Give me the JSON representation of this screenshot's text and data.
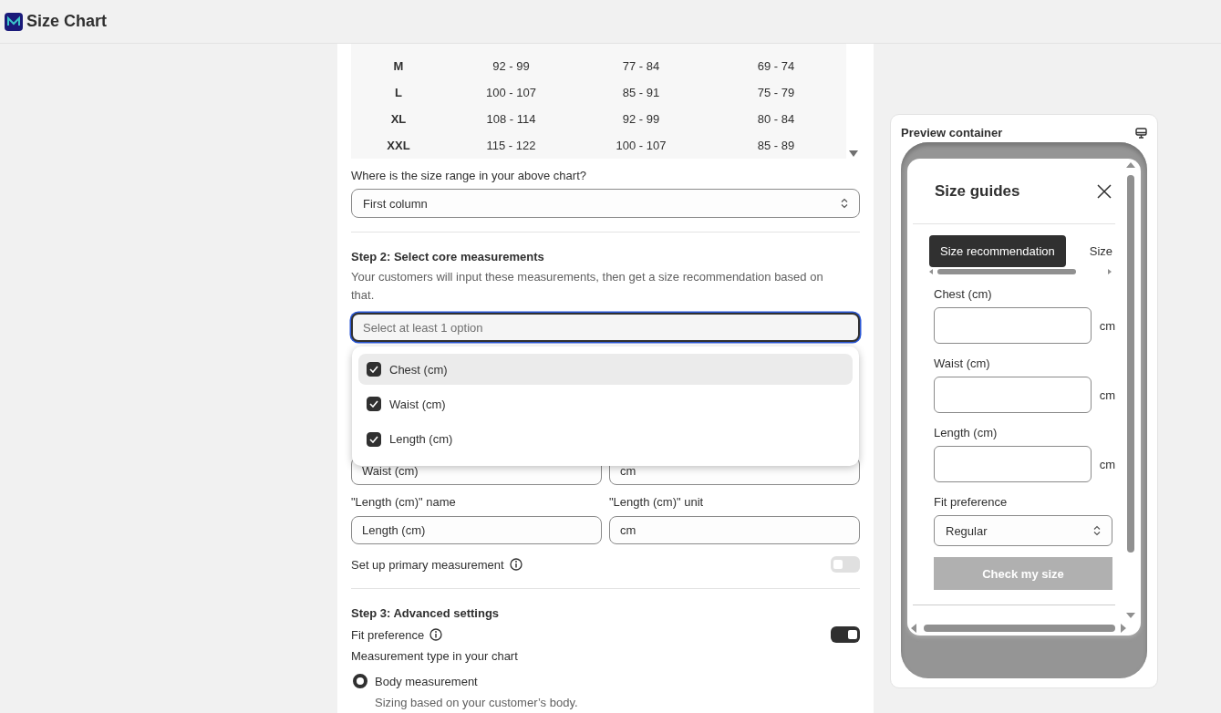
{
  "app": {
    "title": "Size Chart"
  },
  "chart_table": {
    "rows": [
      {
        "size": "M",
        "column_2": "92 - 99",
        "column_3": "77 - 84",
        "column_4": "69 - 74"
      },
      {
        "size": "L",
        "column_2": "100 - 107",
        "column_3": "85 - 91",
        "column_4": "75 - 79"
      },
      {
        "size": "XL",
        "column_2": "108 - 114",
        "column_3": "92 - 99",
        "column_4": "80 - 84"
      },
      {
        "size": "XXL",
        "column_2": "115 - 122",
        "column_3": "100 - 107",
        "column_4": "85 - 89"
      }
    ]
  },
  "size_range": {
    "label": "Where is the size range in your above chart?",
    "value": "First column"
  },
  "step2": {
    "heading": "Step 2: Select core measurements",
    "description": "Your customers will input these measurements, then get a size recommendation based on that.",
    "multiselect": {
      "placeholder": "Select at least 1 option",
      "focused": true,
      "options": [
        {
          "label": "Chest (cm)",
          "checked": true,
          "highlighted": true
        },
        {
          "label": "Waist (cm)",
          "checked": true,
          "highlighted": false
        },
        {
          "label": "Length (cm)",
          "checked": true,
          "highlighted": false
        }
      ]
    },
    "measurements": [
      {
        "name": "Waist (cm)",
        "unit": "cm"
      },
      {
        "name_label": "\"Length (cm)\" name",
        "unit_label": "\"Length (cm)\" unit",
        "name": "Length (cm)",
        "unit": "cm"
      }
    ],
    "primary": {
      "label": "Set up primary measurement",
      "on": false
    }
  },
  "step3": {
    "heading": "Step 3: Advanced settings",
    "fit": {
      "label": "Fit preference",
      "on": true
    },
    "type_label": "Measurement type in your chart",
    "options": [
      {
        "label": "Body measurement",
        "description": "Sizing based on your customer’s body.",
        "selected": true
      }
    ]
  },
  "preview": {
    "title": "Preview container",
    "modal_title": "Size guides",
    "tabs": [
      {
        "label": "Size recommendation",
        "selected": true
      },
      {
        "label": "Size",
        "selected": false
      }
    ],
    "fields": [
      {
        "label": "Chest (cm)",
        "unit": "cm"
      },
      {
        "label": "Waist (cm)",
        "unit": "cm"
      },
      {
        "label": "Length (cm)",
        "unit": "cm"
      }
    ],
    "fit": {
      "label": "Fit preference",
      "value": "Regular"
    },
    "button": {
      "label": "Check my size",
      "disabled": true
    }
  }
}
